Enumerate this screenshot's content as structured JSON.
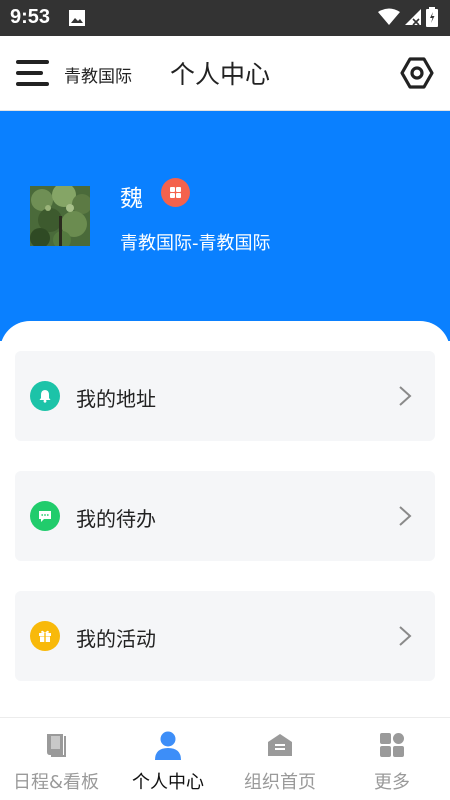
{
  "status_bar": {
    "time": "9:53"
  },
  "app_bar": {
    "org_name": "青教国际",
    "title": "个人中心"
  },
  "profile": {
    "name": "魏",
    "org": "青教国际-青教国际"
  },
  "menu": [
    {
      "label": "我的地址",
      "icon": "bell-icon",
      "color": "#1cc3a8"
    },
    {
      "label": "我的待办",
      "icon": "message-icon",
      "color": "#21cc6c"
    },
    {
      "label": "我的活动",
      "icon": "gift-icon",
      "color": "#f8b90a"
    }
  ],
  "bottom_nav": [
    {
      "label": "日程&看板",
      "icon": "book-icon",
      "active": false
    },
    {
      "label": "个人中心",
      "icon": "person-icon",
      "active": true
    },
    {
      "label": "组织首页",
      "icon": "home-icon",
      "active": false
    },
    {
      "label": "更多",
      "icon": "grid-icon",
      "active": false
    }
  ],
  "colors": {
    "primary": "#0a80ff",
    "badge": "#f4624d",
    "active_nav": "#3d8ef8",
    "inactive_nav": "#9a9a9a"
  }
}
